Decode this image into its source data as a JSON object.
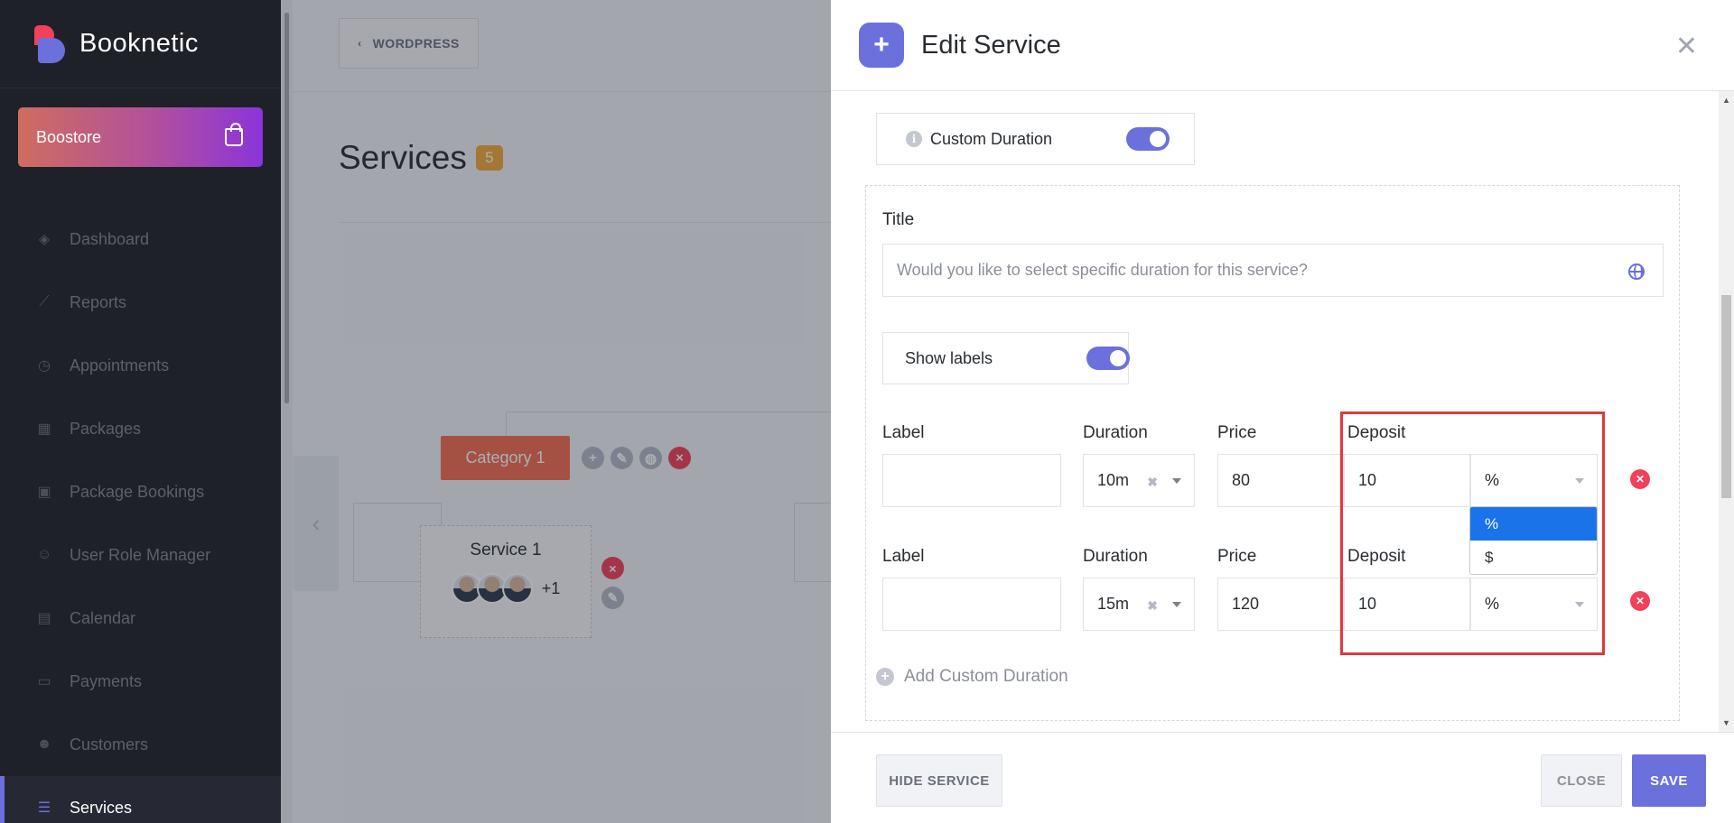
{
  "sidebar": {
    "brand": "Booknetic",
    "boostore": "Boostore",
    "items": [
      {
        "label": "Dashboard",
        "icon": "cube-icon"
      },
      {
        "label": "Reports",
        "icon": "chart-icon"
      },
      {
        "label": "Appointments",
        "icon": "clock-icon"
      },
      {
        "label": "Packages",
        "icon": "boxes-icon"
      },
      {
        "label": "Package Bookings",
        "icon": "gift-icon"
      },
      {
        "label": "User Role Manager",
        "icon": "user-plus-icon"
      },
      {
        "label": "Calendar",
        "icon": "calendar-icon"
      },
      {
        "label": "Payments",
        "icon": "wallet-icon"
      },
      {
        "label": "Customers",
        "icon": "users-icon"
      },
      {
        "label": "Services",
        "icon": "list-icon",
        "active": true
      }
    ]
  },
  "main": {
    "wordpress_label": "WORDPRESS",
    "title": "Services",
    "count": "5",
    "category": "Category 1",
    "service_card": {
      "title": "Service 1",
      "more": "+1"
    }
  },
  "modal": {
    "title": "Edit Service",
    "custom_duration_label": "Custom Duration",
    "title_label": "Title",
    "title_placeholder": "Would you like to select specific duration for this service?",
    "show_labels_label": "Show labels",
    "col_label": "Label",
    "col_duration": "Duration",
    "col_price": "Price",
    "col_deposit": "Deposit",
    "rows": [
      {
        "label": "",
        "duration": "10m",
        "price": "80",
        "deposit": "10",
        "deposit_type": "%"
      },
      {
        "label": "",
        "duration": "15m",
        "price": "120",
        "deposit": "10",
        "deposit_type": "%"
      }
    ],
    "dropdown_options": [
      "%",
      "$"
    ],
    "add_custom_duration": "Add Custom Duration",
    "footer": {
      "hide_service": "HIDE SERVICE",
      "close": "CLOSE",
      "save": "SAVE"
    }
  },
  "colors": {
    "accent": "#6c70dc",
    "danger": "#f2405a",
    "category": "#f36c52",
    "highlight": "#e0383e"
  }
}
